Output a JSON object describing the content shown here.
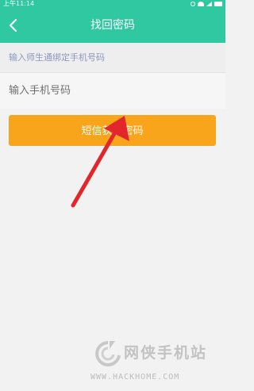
{
  "status_bar": {
    "time": "上午11:14",
    "icons": [
      "alarm-icon",
      "wifi-icon",
      "signal-icon",
      "battery-icon"
    ]
  },
  "header": {
    "title": "找回密码",
    "back_icon": "chevron-left-icon",
    "background": "#2fc8a1"
  },
  "form": {
    "hint": "输入师生通绑定手机号码",
    "phone_placeholder": "输入手机号码",
    "phone_value": "",
    "submit_label": "短信获取密码",
    "submit_color": "#f9a51b"
  },
  "annotation": {
    "arrow_color": "#e3262b"
  },
  "watermark": {
    "cn": "网侠手机站",
    "url": "WWW.HACKHOME.COM"
  }
}
